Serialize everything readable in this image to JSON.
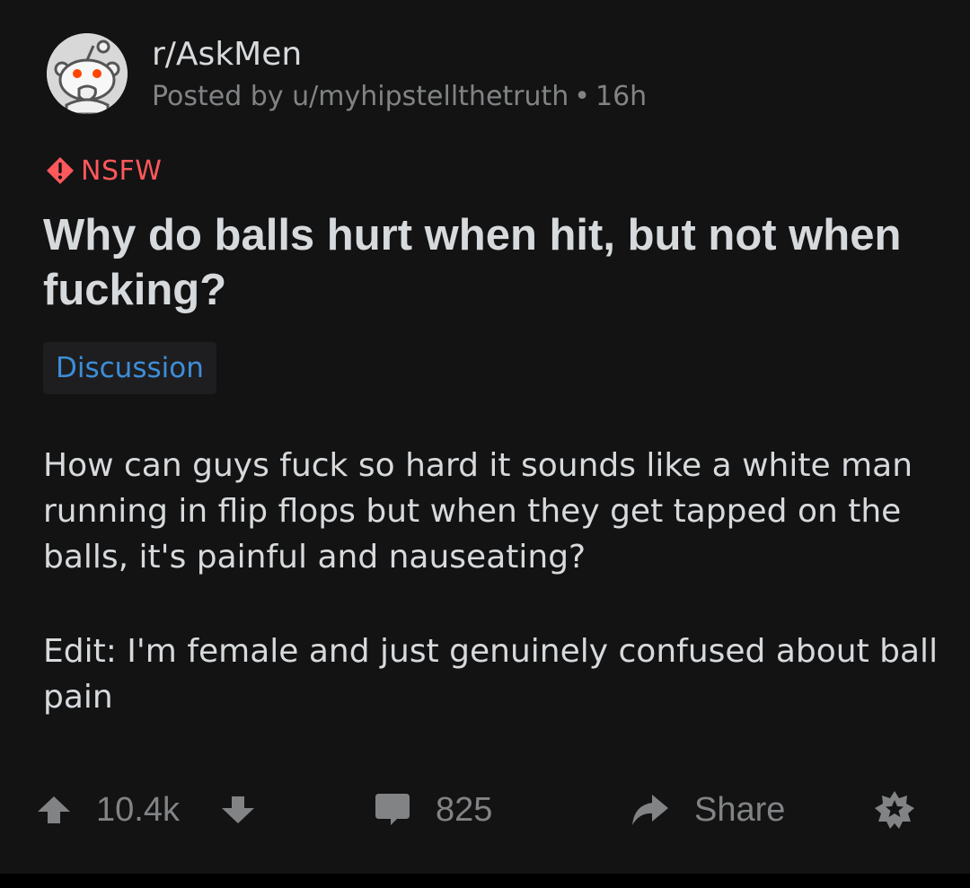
{
  "post": {
    "subreddit": "r/AskMen",
    "posted_by_prefix": "Posted by",
    "author": "u/myhipstellthetruth",
    "separator": "•",
    "age": "16h",
    "nsfw_label": "NSFW",
    "title": "Why do balls hurt when hit, but not when fucking?",
    "flair": "Discussion",
    "body": [
      "How can guys fuck so hard it sounds like a white man running in flip flops but when they get tapped on the balls, it's painful and nauseating?",
      "Edit: I'm female and just genuinely confused about ball pain"
    ]
  },
  "actions": {
    "score": "10.4k",
    "comments": "825",
    "share_label": "Share"
  },
  "icons": {
    "avatar": "subreddit-avatar-icon",
    "nsfw": "nsfw-warning-icon",
    "upvote": "upvote-arrow-icon",
    "downvote": "downvote-arrow-icon",
    "comment": "comment-bubble-icon",
    "share": "share-arrow-icon",
    "award": "award-icon"
  },
  "colors": {
    "background": "#131314",
    "text": "#d7dadc",
    "muted": "#818384",
    "nsfw": "#ff585b",
    "flair_text": "#3d8ed9"
  }
}
